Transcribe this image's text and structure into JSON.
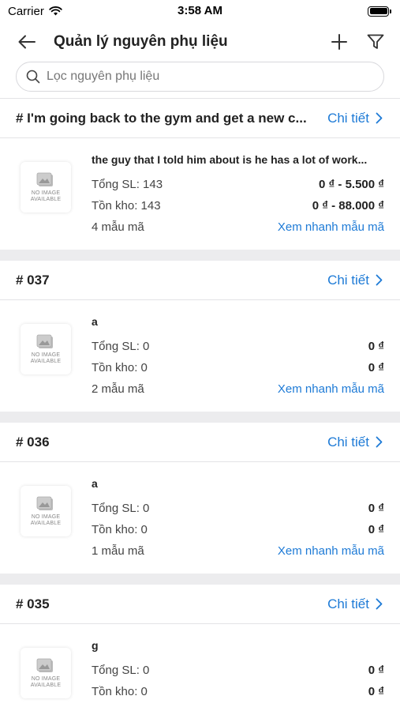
{
  "status": {
    "carrier": "Carrier",
    "time": "3:58 AM"
  },
  "nav": {
    "title": "Quản lý nguyên phụ liệu"
  },
  "search": {
    "placeholder": "Lọc nguyên phụ liệu"
  },
  "labels": {
    "detail": "Chi tiết",
    "quick_view": "Xem nhanh mẫu mã",
    "no_image_line1": "NO IMAGE",
    "no_image_line2": "AVAILABLE"
  },
  "groups": [
    {
      "code": "# I'm going back to the gym and get a new c...",
      "item": {
        "name": "the guy that I told him about is he has a lot of work...",
        "total_qty": "Tổng SL: 143",
        "stock": "Tồn kho: 143",
        "price_total": "0 ₫ - 5.500 ₫",
        "price_stock": "0 ₫ - 88.000 ₫",
        "variants": "4 mẫu mã"
      }
    },
    {
      "code": "# 037",
      "item": {
        "name": "a",
        "total_qty": "Tổng SL: 0",
        "stock": "Tồn kho: 0",
        "price_total": "0 ₫",
        "price_stock": "0 ₫",
        "variants": "2 mẫu mã"
      }
    },
    {
      "code": "# 036",
      "item": {
        "name": "a",
        "total_qty": "Tổng SL: 0",
        "stock": "Tồn kho: 0",
        "price_total": "0 ₫",
        "price_stock": "0 ₫",
        "variants": "1 mẫu mã"
      }
    },
    {
      "code": "# 035",
      "item": {
        "name": "g",
        "total_qty": "Tổng SL: 0",
        "stock": "Tồn kho: 0",
        "price_total": "0 ₫",
        "price_stock": "0 ₫",
        "variants": ""
      }
    }
  ],
  "colors": {
    "accent": "#1d7ad6",
    "divider": "#ececee"
  }
}
